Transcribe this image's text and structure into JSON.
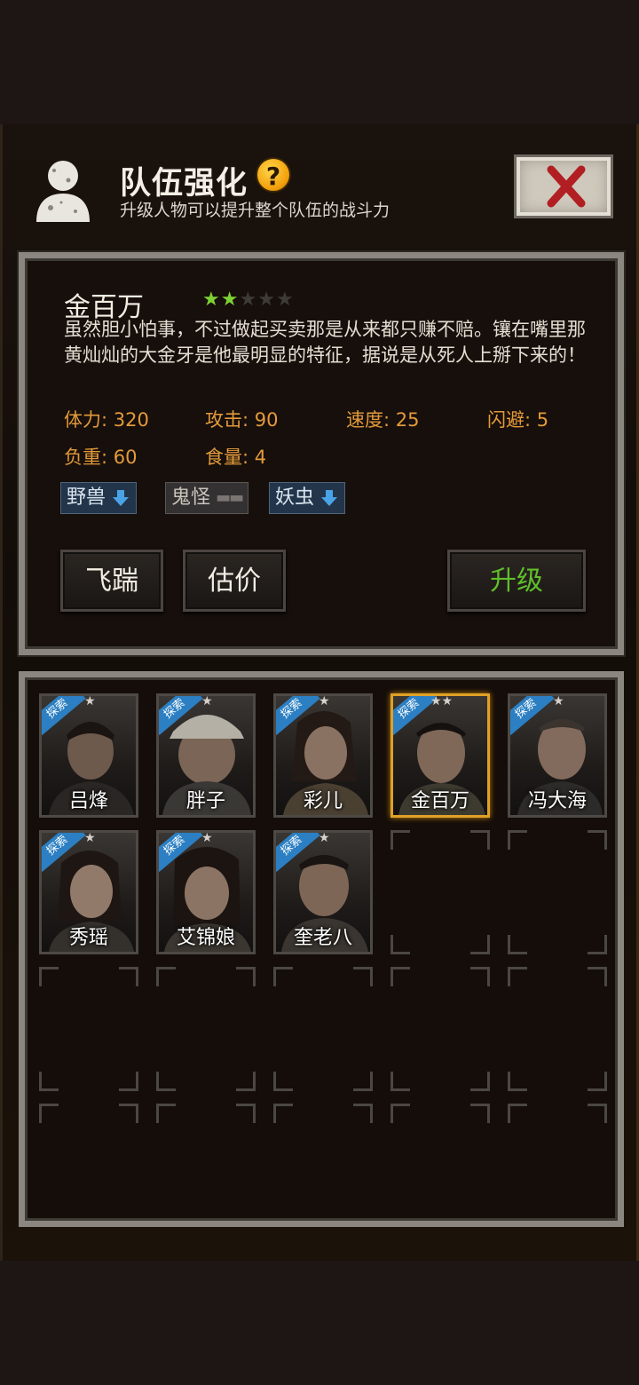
{
  "header": {
    "title": "队伍强化",
    "help_icon": "question-mark-icon",
    "subtitle": "升级人物可以提升整个队伍的战斗力",
    "close_icon": "close-x-icon"
  },
  "selected_character": {
    "name": "金百万",
    "stars_filled": 2,
    "stars_total": 5,
    "description": "虽然胆小怕事，不过做起买卖那是从来都只赚不赔。镶在嘴里那黄灿灿的大金牙是他最明显的特征，据说是从死人上掰下来的！",
    "stats": {
      "hp": "体力: 320",
      "attack": "攻击: 90",
      "speed": "速度: 25",
      "dodge": "闪避: 5",
      "load": "负重: 60",
      "food": "食量: 4"
    },
    "traits": [
      {
        "label": "野兽",
        "indicator": "down-arrow-icon"
      },
      {
        "label": "鬼怪",
        "indicator": "neutral-dash-icon"
      },
      {
        "label": "妖虫",
        "indicator": "down-arrow-icon"
      }
    ],
    "buttons": {
      "kick": "飞踹",
      "appraise": "估价",
      "upgrade": "升级"
    }
  },
  "roster": {
    "badge_text": "探索",
    "characters": [
      {
        "name": "吕烽",
        "stars": "★"
      },
      {
        "name": "胖子",
        "stars": "★"
      },
      {
        "name": "彩儿",
        "stars": "★"
      },
      {
        "name": "金百万",
        "stars": "★★"
      },
      {
        "name": "冯大海",
        "stars": "★"
      },
      {
        "name": "秀瑶",
        "stars": "★"
      },
      {
        "name": "艾锦娘",
        "stars": "★"
      },
      {
        "name": "奎老八",
        "stars": "★"
      }
    ],
    "selected_index": 3
  },
  "colors": {
    "stat_orange": "#e39a3b",
    "star_green": "#7cd235",
    "selection_gold": "#e0a126",
    "badge_blue": "#2b7fc2",
    "upgrade_green": "#5fbf2a"
  }
}
